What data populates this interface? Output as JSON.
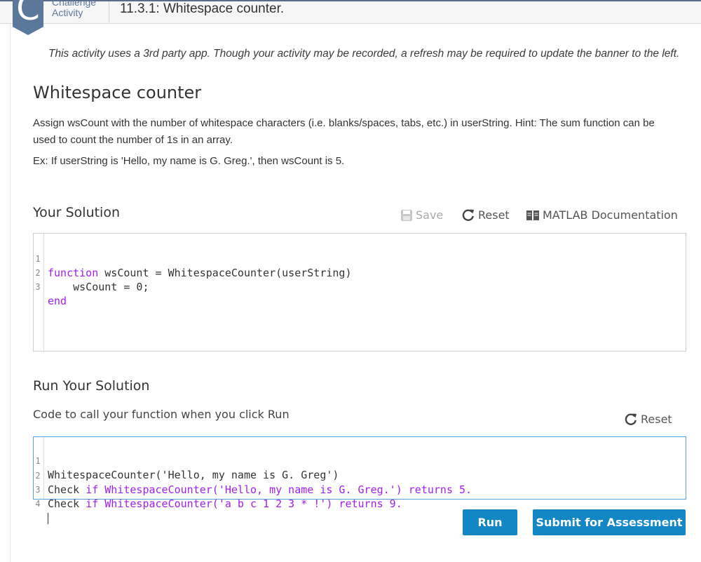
{
  "header": {
    "badge_letter": "C",
    "type_label_line1": "Challenge",
    "type_label_line2": "Activity",
    "activity_title": "11.3.1: Whitespace counter."
  },
  "notice": "This activity uses a 3rd party app. Though your activity may be recorded, a refresh may be required to update the banner to the left.",
  "problem": {
    "title": "Whitespace counter",
    "description": "Assign wsCount with the number of whitespace characters (i.e. blanks/spaces, tabs, etc.) in userString. Hint: The sum function can be used to count the number of 1s in an array.",
    "example": "Ex: If userString is 'Hello, my name is G. Greg.', then wsCount is 5."
  },
  "solution": {
    "heading": "Your Solution",
    "save_label": "Save",
    "reset_label": "Reset",
    "docs_label": "MATLAB Documentation",
    "line_numbers": [
      "1",
      "2",
      "3"
    ],
    "lines": [
      {
        "kw": "function",
        "rest": " wsCount = WhitespaceCounter(userString)"
      },
      {
        "kw": "",
        "rest": "    wsCount = 0;"
      },
      {
        "kw": "end",
        "rest": ""
      }
    ]
  },
  "run": {
    "heading": "Run Your Solution",
    "subheading": "Code to call your function when you click Run",
    "reset_label": "Reset",
    "line_numbers": [
      "1",
      "2",
      "3",
      "4"
    ],
    "line1": "WhitespaceCounter('Hello, my name is G. Greg')",
    "line2_prefix": "Check ",
    "line2_rest": "if WhitespaceCounter('Hello, my name is G. Greg.') returns 5.",
    "line3_prefix": "Check ",
    "line3_rest": "if WhitespaceCounter('a b c 1 2 3 * !') returns 9.",
    "run_button": "Run",
    "submit_button": "Submit for Assessment"
  },
  "colors": {
    "accent": "#1387c6",
    "badge": "#5a7899",
    "keyword": "#a020f0"
  }
}
